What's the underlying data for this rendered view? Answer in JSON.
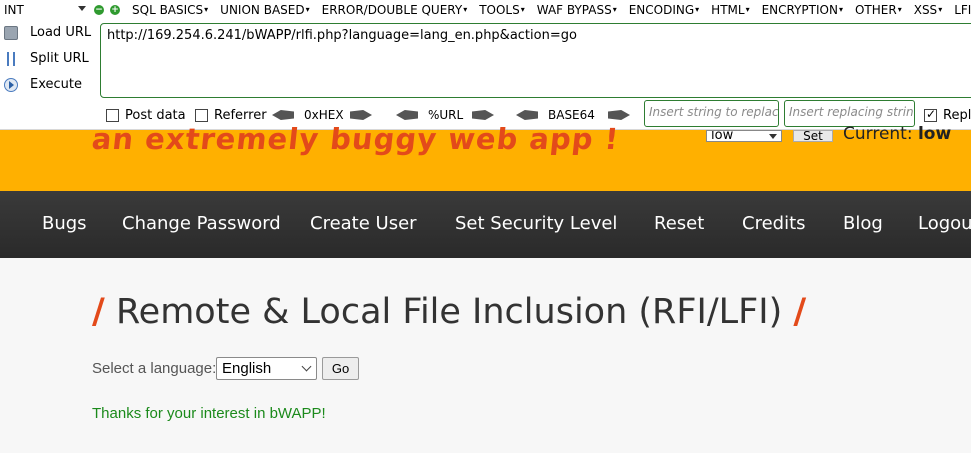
{
  "hackbar": {
    "mode_select": "INT",
    "menu": [
      "SQL BASICS",
      "UNION BASED",
      "ERROR/DOUBLE QUERY",
      "TOOLS",
      "WAF BYPASS",
      "ENCODING",
      "HTML",
      "ENCRYPTION",
      "OTHER",
      "XSS",
      "LFI"
    ],
    "buttons": {
      "load_url": "Load URL",
      "split_url": "Split URL",
      "execute": "Execute"
    },
    "url_value": "http://169.254.6.241/bWAPP/rlfi.php?language=lang_en.php&action=go",
    "post_data": "Post data",
    "referrer": "Referrer",
    "hex": "0xHEX",
    "url_enc": "%URL",
    "base64": "BASE64",
    "insert_placeholder": "Insert string to replace",
    "replacing_placeholder": "Insert replacing string",
    "replace_all": "Repl"
  },
  "header": {
    "tagline": "an extremely buggy web app !",
    "security_select_value": "low",
    "set_button": "Set",
    "current_label": "Current:",
    "current_value": "low"
  },
  "nav": [
    "Bugs",
    "Change Password",
    "Create User",
    "Set Security Level",
    "Reset",
    "Credits",
    "Blog",
    "Logout"
  ],
  "main": {
    "title": "Remote & Local File Inclusion (RFI/LFI)",
    "slash": "/",
    "lang_label": "Select a language:",
    "lang_value": "English",
    "go_button": "Go",
    "thanks": "Thanks for your interest in bWAPP!"
  },
  "colors": {
    "orange": "#ffb000",
    "accent": "#e34a1a",
    "nav_bg": "#2e2e2e",
    "success_text": "#1b8a1b",
    "hackbar_border": "#2e7d32"
  }
}
